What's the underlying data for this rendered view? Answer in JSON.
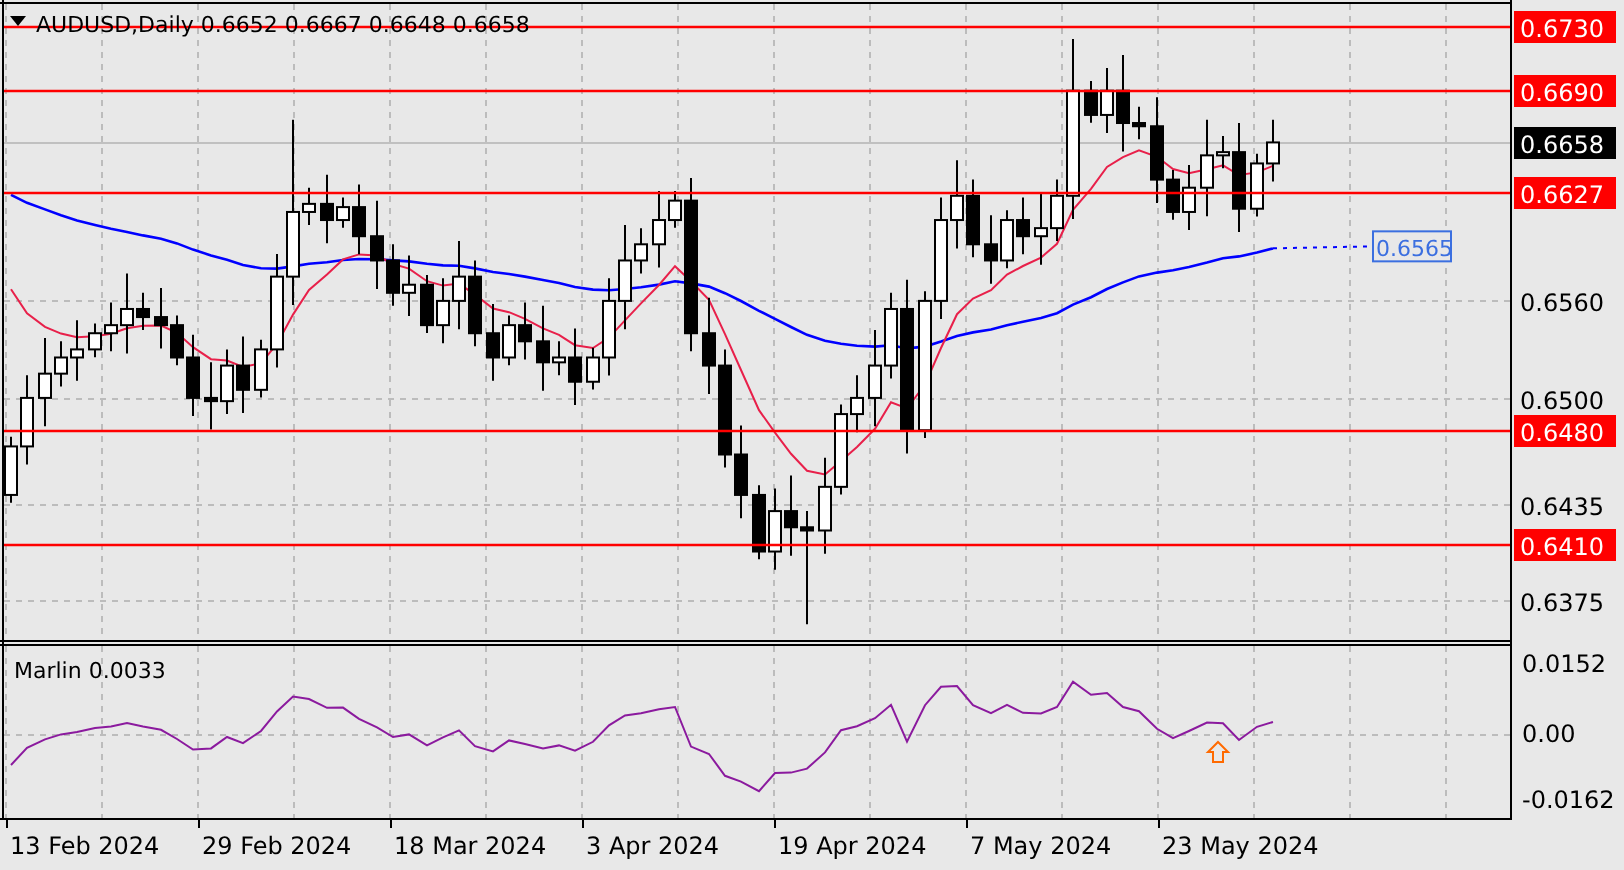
{
  "chart": {
    "title": "AUDUSD,Daily 0.6652 0.6667 0.6648 0.6658",
    "price_axis": [
      {
        "label": "0.6730",
        "kind": "level"
      },
      {
        "label": "0.6690",
        "kind": "level"
      },
      {
        "label": "0.6658",
        "kind": "current"
      },
      {
        "label": "0.6627",
        "kind": "level"
      },
      {
        "label": "0.6560",
        "kind": "tick"
      },
      {
        "label": "0.6500",
        "kind": "tick"
      },
      {
        "label": "0.6480",
        "kind": "level"
      },
      {
        "label": "0.6435",
        "kind": "tick"
      },
      {
        "label": "0.6410",
        "kind": "level"
      },
      {
        "label": "0.6375",
        "kind": "tick"
      }
    ],
    "ma_label": "0.6565",
    "indicator": {
      "title": "Marlin 0.0033",
      "axis": [
        "0.0152",
        "0.00",
        "-0.0162"
      ]
    },
    "dates": [
      "13 Feb 2024",
      "29 Feb 2024",
      "18 Mar 2024",
      "3 Apr 2024",
      "19 Apr 2024",
      "7 May 2024",
      "23 May 2024"
    ]
  }
}
